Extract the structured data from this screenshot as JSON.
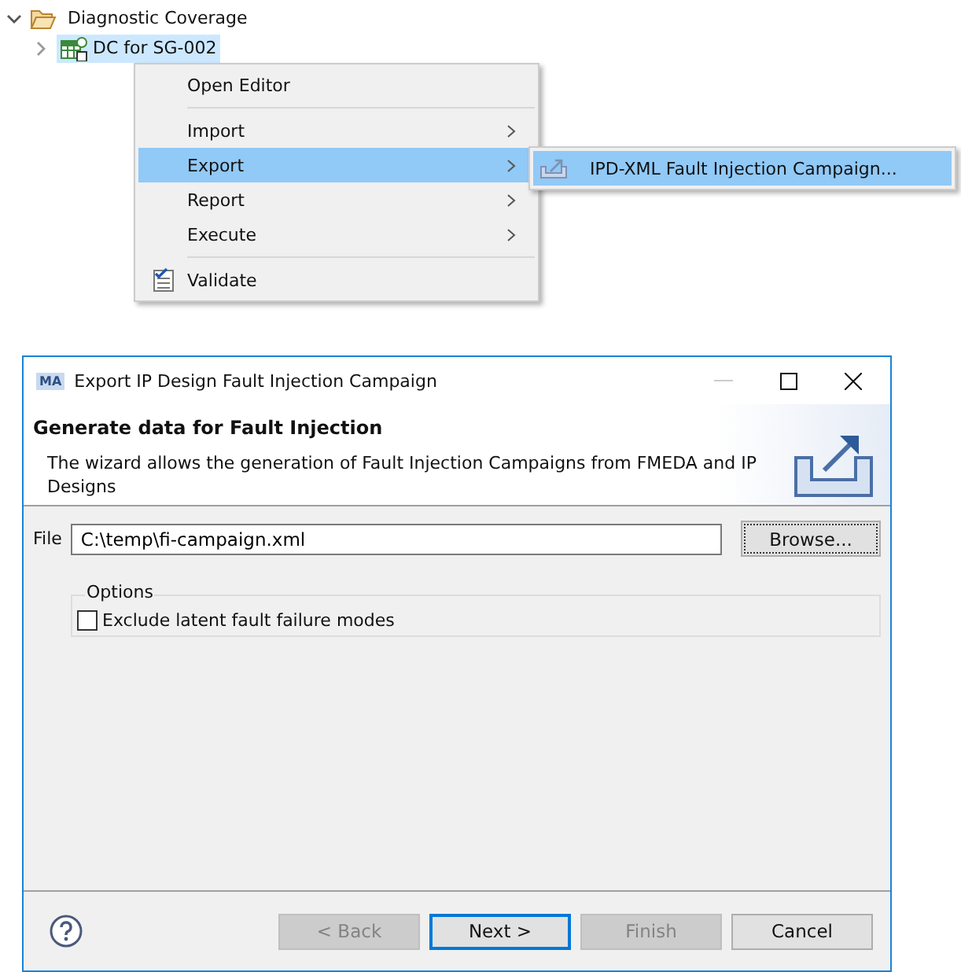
{
  "tree": [
    {
      "label": "Diagnostic Coverage",
      "expanded": true,
      "selected": false,
      "children": [
        {
          "label": "DC for SG-002",
          "expanded": false,
          "selected": true
        }
      ]
    }
  ],
  "context_menu": {
    "items": [
      {
        "kind": "item",
        "label": "Open Editor",
        "submenu": false,
        "selected": false
      },
      {
        "kind": "separator"
      },
      {
        "kind": "item",
        "label": "Import",
        "submenu": true,
        "selected": false
      },
      {
        "kind": "item",
        "label": "Export",
        "submenu": true,
        "selected": true
      },
      {
        "kind": "item",
        "label": "Report",
        "submenu": true,
        "selected": false
      },
      {
        "kind": "item",
        "label": "Execute",
        "submenu": true,
        "selected": false
      },
      {
        "kind": "separator"
      },
      {
        "kind": "item",
        "label": "Validate",
        "submenu": false,
        "selected": false,
        "icon": true
      }
    ],
    "submenu": [
      {
        "label": "IPD-XML Fault Injection Campaign...",
        "selected": true
      }
    ]
  },
  "dialog": {
    "title": "Export IP Design Fault Injection Campaign",
    "app_badge": "MA",
    "heading": "Generate data for Fault Injection",
    "description": "The wizard allows the generation of Fault Injection Campaigns from FMEDA and IP Designs",
    "file_label": "File",
    "file_value": "C:\\temp\\fi-campaign.xml",
    "browse_button": "Browse...",
    "options_title": "Options",
    "options": [
      {
        "label": "Exclude latent fault failure modes",
        "checked": false
      }
    ],
    "buttons": [
      {
        "label": "< Back",
        "disabled": true,
        "default": false
      },
      {
        "label": "Next >",
        "disabled": false,
        "default": true
      },
      {
        "label": "Finish",
        "disabled": true,
        "default": false
      },
      {
        "label": "Cancel",
        "disabled": false,
        "default": false
      }
    ]
  }
}
